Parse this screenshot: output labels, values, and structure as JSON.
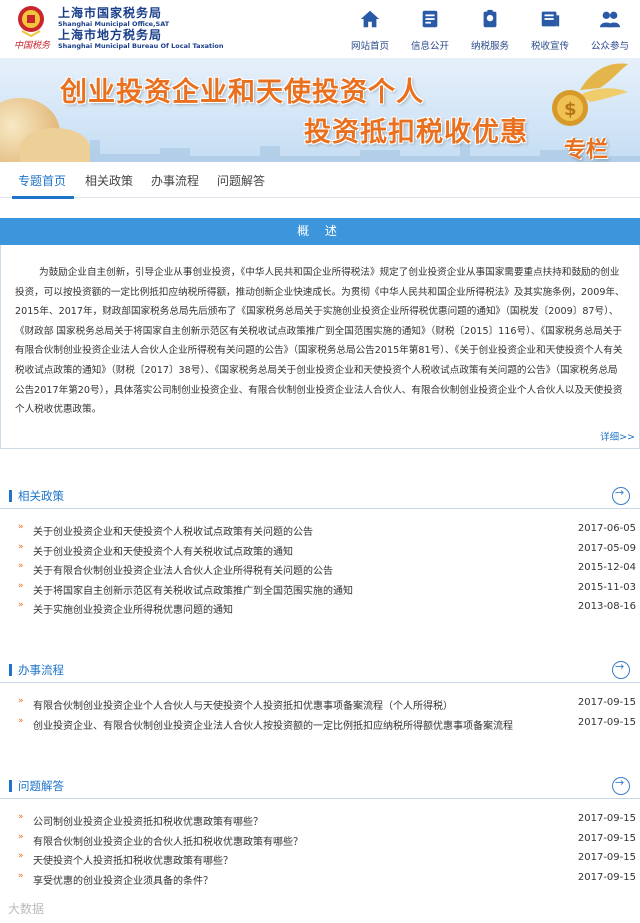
{
  "header": {
    "org1_cn": "上海市国家税务局",
    "org1_en": "Shanghai Municipal Office,SAT",
    "org2_cn": "上海市地方税务局",
    "org2_en": "Shanghai Municipal Bureau Of Local Taxation",
    "slogan": "中国税务",
    "nav": [
      {
        "label": "网站首页",
        "icon": "home-icon"
      },
      {
        "label": "信息公开",
        "icon": "document-icon"
      },
      {
        "label": "纳税服务",
        "icon": "service-icon"
      },
      {
        "label": "税收宣传",
        "icon": "publicity-icon"
      },
      {
        "label": "公众参与",
        "icon": "people-icon"
      }
    ]
  },
  "banner": {
    "line1": "创业投资企业和天使投资个人",
    "line2": "投资抵扣税收优惠",
    "tag": "专栏"
  },
  "tabs": [
    "专题首页",
    "相关政策",
    "办事流程",
    "问题解答"
  ],
  "overview": {
    "title": "概 述",
    "text": "为鼓励企业自主创新，引导企业从事创业投资，《中华人民共和国企业所得税法》规定了创业投资企业从事国家需要重点扶持和鼓励的创业投资，可以按投资额的一定比例抵扣应纳税所得额，推动创新企业快速成长。为贯彻《中华人民共和国企业所得税法》及其实施条例，2009年、2015年、2017年，财政部国家税务总局先后颁布了《国家税务总局关于实施创业投资企业所得税优惠问题的通知》（国税发〔2009〕87号）、《财政部 国家税务总局关于将国家自主创新示范区有关税收试点政策推广到全国范围实施的通知》（财税〔2015〕116号）、《国家税务总局关于有限合伙制创业投资企业法人合伙人企业所得税有关问题的公告》（国家税务总局公告2015年第81号）、《关于创业投资企业和天使投资个人有关税收试点政策的通知》（财税〔2017〕38号）、《国家税务总局关于创业投资企业和天使投资个人税收试点政策有关问题的公告》（国家税务总局公告2017年第20号），具体落实公司制创业投资企业、有限合伙制创业投资企业法人合伙人、有限合伙制创业投资企业个人合伙人以及天使投资个人税收优惠政策。",
    "more": "详细>>"
  },
  "policy": {
    "title": "相关政策",
    "items": [
      {
        "text": "关于创业投资企业和天使投资个人税收试点政策有关问题的公告",
        "date": "2017-06-05"
      },
      {
        "text": "关于创业投资企业和天使投资个人有关税收试点政策的通知",
        "date": "2017-05-09"
      },
      {
        "text": "关于有限合伙制创业投资企业法人合伙人企业所得税有关问题的公告",
        "date": "2015-12-04"
      },
      {
        "text": "关于将国家自主创新示范区有关税收试点政策推广到全国范围实施的通知",
        "date": "2015-11-03"
      },
      {
        "text": "关于实施创业投资企业所得税优惠问题的通知",
        "date": "2013-08-16"
      }
    ]
  },
  "process": {
    "title": "办事流程",
    "items": [
      {
        "text": "有限合伙制创业投资企业个人合伙人与天使投资个人投资抵扣优惠事项备案流程（个人所得税）",
        "date": "2017-09-15"
      },
      {
        "text": "创业投资企业、有限合伙制创业投资企业法人合伙人按投资额的一定比例抵扣应纳税所得额优惠事项备案流程",
        "date": "2017-09-15"
      }
    ]
  },
  "faq": {
    "title": "问题解答",
    "items": [
      {
        "text": "公司制创业投资企业投资抵扣税收优惠政策有哪些？",
        "date": "2017-09-15"
      },
      {
        "text": "有限合伙制创业投资企业的合伙人抵扣税收优惠政策有哪些？",
        "date": "2017-09-15"
      },
      {
        "text": "天使投资个人投资抵扣税收优惠政策有哪些？",
        "date": "2017-09-15"
      },
      {
        "text": "享受优惠的创业投资企业须具备的条件？",
        "date": "2017-09-15"
      }
    ]
  },
  "watermark": "大数据"
}
